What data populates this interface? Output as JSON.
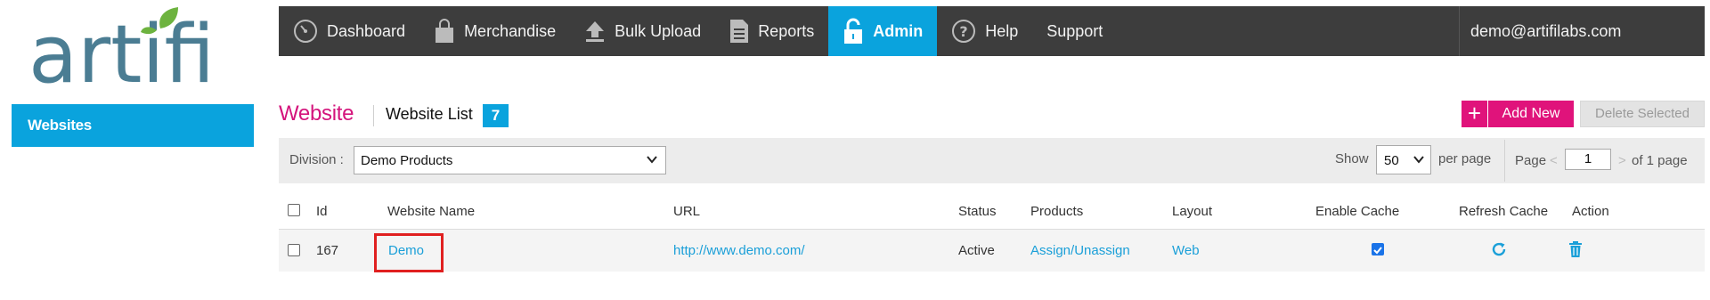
{
  "logo": {
    "text": "artifi"
  },
  "sidebar": {
    "items": [
      {
        "label": "Websites"
      }
    ]
  },
  "nav": {
    "items": [
      {
        "label": "Dashboard",
        "icon": "dashboard-gauge-icon"
      },
      {
        "label": "Merchandise",
        "icon": "shopping-bag-icon"
      },
      {
        "label": "Bulk Upload",
        "icon": "upload-arrow-icon"
      },
      {
        "label": "Reports",
        "icon": "document-icon"
      },
      {
        "label": "Admin",
        "icon": "lock-icon",
        "active": true
      },
      {
        "label": "Help",
        "icon": "question-circle-icon"
      },
      {
        "label": "Support"
      }
    ],
    "user": "demo@artifilabs.com"
  },
  "page": {
    "title": "Website",
    "subtitle": "Website List",
    "count": "7",
    "add_plus": "+",
    "add_label": "Add New",
    "delete_label": "Delete Selected"
  },
  "filters": {
    "division_label": "Division :",
    "division_value": "Demo Products",
    "show_label": "Show",
    "per_page_value": "50",
    "per_page_label": "per page",
    "page_label": "Page",
    "prev": "<",
    "page_value": "1",
    "next": ">",
    "of_pages": "of 1 page"
  },
  "table": {
    "columns": [
      "Id",
      "Website Name",
      "URL",
      "Status",
      "Products",
      "Layout",
      "Enable Cache",
      "Refresh Cache",
      "Action"
    ],
    "rows": [
      {
        "id": "167",
        "name": "Demo",
        "url": "http://www.demo.com/",
        "status": "Active",
        "products": "Assign/Unassign",
        "layout": "Web",
        "enable_cache": true,
        "refresh_icon": "refresh-icon",
        "action_icon": "trash-icon"
      }
    ]
  },
  "colors": {
    "accent_blue": "#0aa3dd",
    "brand_pink": "#e0137b",
    "title_pink": "#d4147c",
    "nav_dark": "#3d3d3d",
    "logo_blue": "#4b7d93",
    "leaf_green": "#6db33f",
    "highlight_red": "#e02020"
  }
}
